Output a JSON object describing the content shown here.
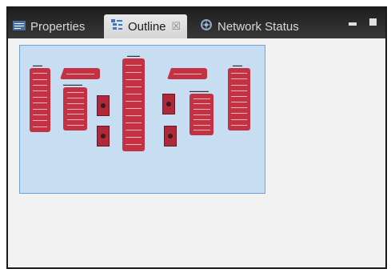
{
  "tabs": [
    {
      "label": "Properties",
      "icon": "properties-icon"
    },
    {
      "label": "Outline",
      "icon": "outline-icon",
      "close": "☒"
    },
    {
      "label": "Network Status",
      "icon": "network-status-icon"
    }
  ],
  "colors": {
    "rack": "#c33142",
    "viewport": "#c7ddf2",
    "tabbar": "#2b2b2b"
  }
}
